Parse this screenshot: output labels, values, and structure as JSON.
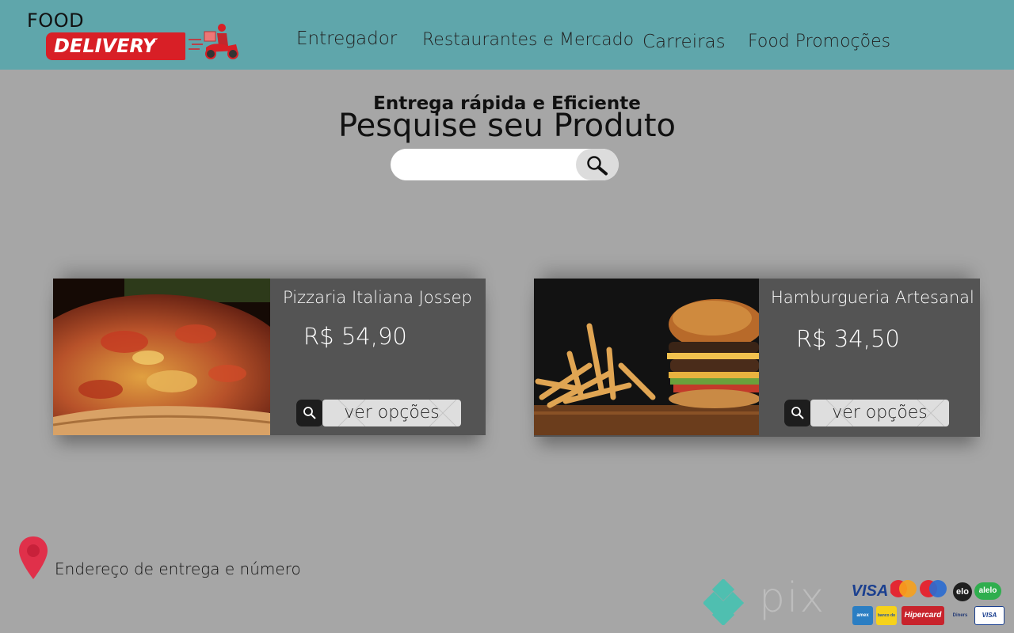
{
  "header": {
    "logo": {
      "top": "FOOD",
      "main": "DELIVERY"
    },
    "nav": [
      {
        "label": "Entregador"
      },
      {
        "label": "Restaurantes e Mercado"
      },
      {
        "label": "Carreiras"
      },
      {
        "label": "Food Promoções"
      }
    ]
  },
  "hero": {
    "subtitle": "Entrega rápida e Eficiente",
    "title": "Pesquise seu Produto",
    "search_value": "",
    "search_placeholder": ""
  },
  "cards": [
    {
      "name": "Pizzaria Italiana Jossep",
      "price": "R$ 54,90",
      "button": "ver opções"
    },
    {
      "name": "Hamburgueria Artesanal",
      "price": "R$ 34,50",
      "button": "ver opções"
    }
  ],
  "footer": {
    "address": "Endereço de entrega e número",
    "pix": "pix",
    "payment_methods": [
      "VISA",
      "mastercard",
      "maestro",
      "elo",
      "alelo",
      "amex",
      "banco do brasil",
      "Hipercard",
      "Diners Club",
      "VISA Electron"
    ]
  },
  "colors": {
    "header_bg": "#5fa6ab",
    "page_bg": "#a6a6a6",
    "card_bg": "#545454",
    "brand_red": "#d81f26"
  }
}
